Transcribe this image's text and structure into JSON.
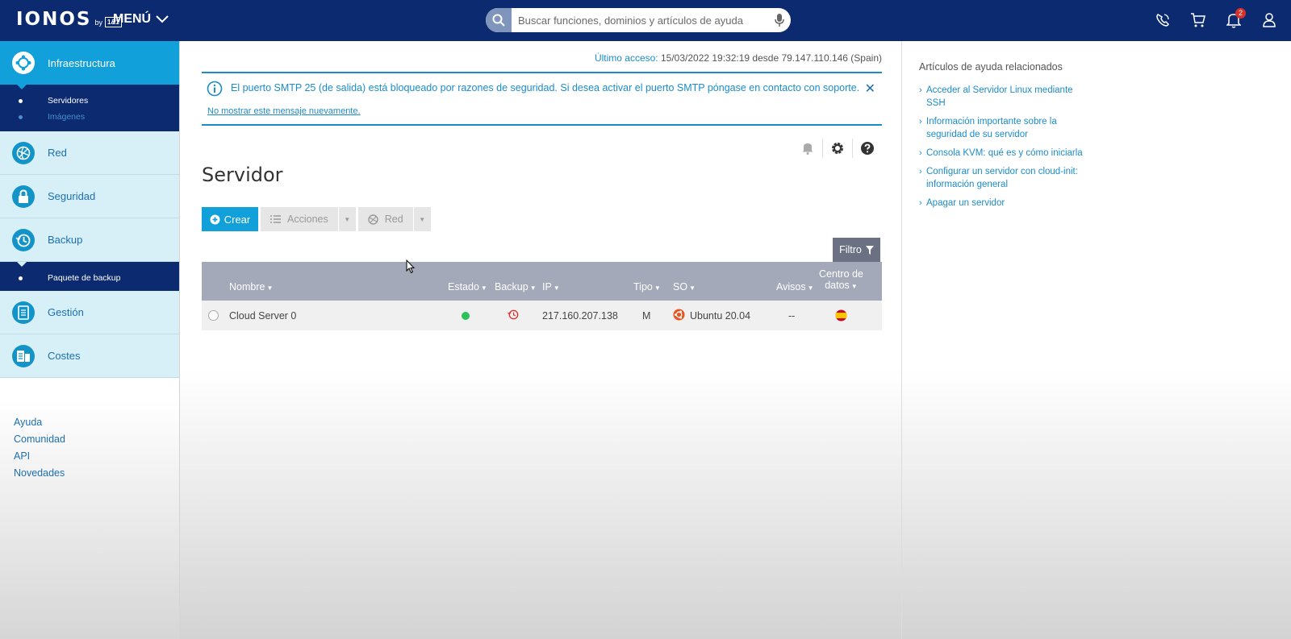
{
  "header": {
    "brand": "IONOS",
    "brand_by": "by",
    "brand_box": "1&1",
    "menu_label": "MENÚ",
    "search_placeholder": "Buscar funciones, dominios y artículos de ayuda",
    "notification_count": "2",
    "icons": [
      "phone-icon",
      "cart-icon",
      "bell-icon",
      "user-icon"
    ]
  },
  "sidebar": {
    "items": [
      {
        "label": "Infraestructura",
        "icon": "infrastructure-icon",
        "active": true
      },
      {
        "label": "Red",
        "icon": "network-globe-icon"
      },
      {
        "label": "Seguridad",
        "icon": "lock-icon"
      },
      {
        "label": "Backup",
        "icon": "clock-backup-icon"
      },
      {
        "label": "Gestión",
        "icon": "document-icon"
      },
      {
        "label": "Costes",
        "icon": "costs-icon"
      }
    ],
    "infra_sub": [
      "Servidores",
      "Imágenes"
    ],
    "backup_sub": [
      "Paquete de backup"
    ],
    "links": [
      "Ayuda",
      "Comunidad",
      "API",
      "Novedades"
    ]
  },
  "main": {
    "last_access_label": "Último acceso:",
    "last_access_value": "15/03/2022 19:32:19 desde 79.147.110.146 (Spain)",
    "notice_text": "El puerto SMTP 25 (de salida) está bloqueado por razones de seguridad. Si desea activar el puerto SMTP póngase en contacto con",
    "notice_link": "soporte",
    "notice_end": ".",
    "notice_hide": "No mostrar este mensaje nuevamente.",
    "title": "Servidor",
    "buttons": {
      "create": "Crear",
      "actions": "Acciones",
      "network": "Red",
      "filter": "Filtro"
    },
    "table": {
      "headers": {
        "name": "Nombre",
        "state": "Estado",
        "backup": "Backup",
        "ip": "IP",
        "type": "Tipo",
        "os": "SO",
        "alerts": "Avisos",
        "dc1": "Centro de",
        "dc2": "datos"
      },
      "rows": [
        {
          "name": "Cloud Server 0",
          "status": "running",
          "ip": "217.160.207.138",
          "type": "M",
          "os": "Ubuntu 20.04",
          "alerts": "--",
          "datacenter": "Spain"
        }
      ]
    }
  },
  "help": {
    "title": "Artículos de ayuda relacionados",
    "articles": [
      {
        "l1": "Acceder al Servidor Linux mediante",
        "l2": "SSH"
      },
      {
        "l1": "Información importante sobre la",
        "l2": "seguridad de su servidor"
      },
      {
        "l1": "Consola KVM: qué es y cómo iniciarla",
        "l2": ""
      },
      {
        "l1": "Configurar un servidor con cloud-init:",
        "l2": "información general"
      },
      {
        "l1": "Apagar un servidor",
        "l2": ""
      }
    ]
  },
  "colors": {
    "navy": "#0b2a6f",
    "accent": "#11a0d9",
    "light_nav": "#d7f0f7",
    "link": "#1b8cc9",
    "status_ok": "#2cc25a"
  }
}
